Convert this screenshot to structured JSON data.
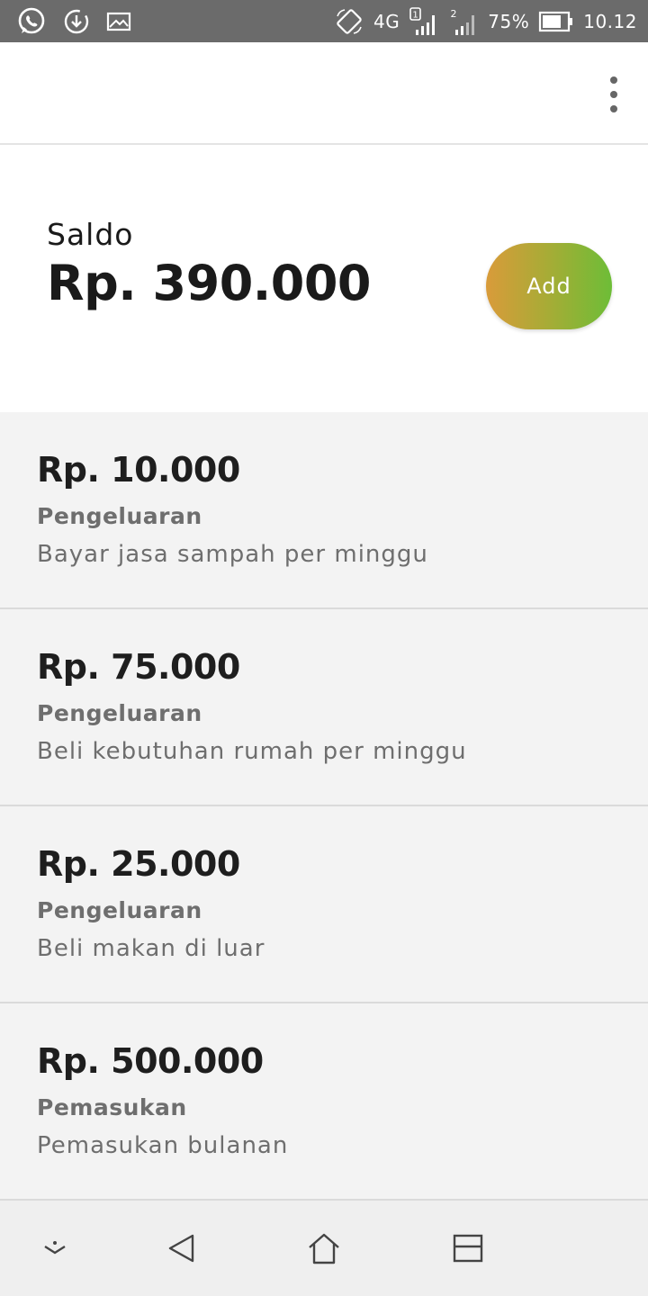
{
  "status_bar": {
    "network": "4G",
    "battery": "75%",
    "time": "10.12"
  },
  "balance": {
    "label": "Saldo",
    "amount": "Rp. 390.000",
    "add_label": "Add"
  },
  "transactions": [
    {
      "amount": "Rp. 10.000",
      "type": "Pengeluaran",
      "description": "Bayar jasa sampah per minggu"
    },
    {
      "amount": "Rp. 75.000",
      "type": "Pengeluaran",
      "description": "Beli kebutuhan rumah per minggu"
    },
    {
      "amount": "Rp. 25.000",
      "type": "Pengeluaran",
      "description": "Beli makan di luar"
    },
    {
      "amount": "Rp. 500.000",
      "type": "Pemasukan",
      "description": "Pemasukan bulanan"
    }
  ],
  "colors": {
    "status_bar": "#6b6b6b",
    "add_gradient_start": "#d99b3a",
    "add_gradient_end": "#6dbd37",
    "list_background": "#f3f3f3"
  },
  "icons": {
    "status_left": [
      "whatsapp-icon",
      "download-icon",
      "image-icon"
    ],
    "status_right": [
      "rotate-icon",
      "signal-sim1-icon",
      "signal-sim2-icon",
      "battery-icon"
    ],
    "nav": [
      "collapse-icon",
      "back-icon",
      "home-icon",
      "recents-icon"
    ]
  }
}
